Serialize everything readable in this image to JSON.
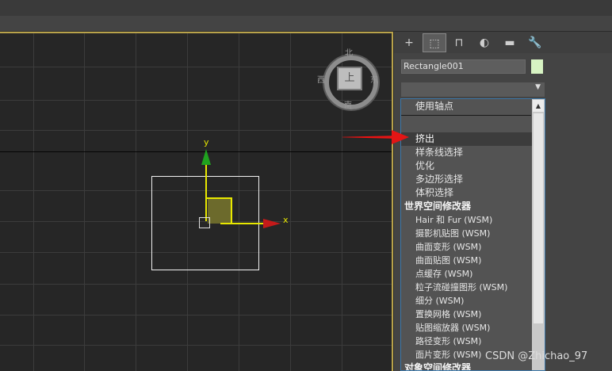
{
  "viewport": {
    "compass": {
      "north": "北",
      "south": "南",
      "east": "东",
      "west": "西",
      "top": "上"
    },
    "gizmo": {
      "x_label": "x",
      "y_label": "y"
    }
  },
  "panel": {
    "tabs": [
      {
        "icon": "plus-icon",
        "glyph": "+"
      },
      {
        "icon": "modify-icon",
        "glyph": "⬚"
      },
      {
        "icon": "hierarchy-icon",
        "glyph": "⊓"
      },
      {
        "icon": "motion-icon",
        "glyph": "◐"
      },
      {
        "icon": "display-icon",
        "glyph": "▬"
      },
      {
        "icon": "utilities-icon",
        "glyph": "🔧"
      }
    ],
    "object_name": "Rectangle001",
    "object_color": "#d7f3c3",
    "modifier_list_value": "",
    "dropdown": {
      "top_item": "使用轴点",
      "items": [
        {
          "label": "挤出",
          "kind": "sub",
          "highlighted": true
        },
        {
          "label": "样条线选择",
          "kind": "sub"
        },
        {
          "label": "优化",
          "kind": "sub"
        },
        {
          "label": "多边形选择",
          "kind": "sub"
        },
        {
          "label": "体积选择",
          "kind": "sub"
        },
        {
          "label": "世界空间修改器",
          "kind": "header"
        },
        {
          "label": "Hair 和 Fur (WSM)",
          "kind": "sub"
        },
        {
          "label": "摄影机贴图 (WSM)",
          "kind": "sub"
        },
        {
          "label": "曲面变形 (WSM)",
          "kind": "sub"
        },
        {
          "label": "曲面贴图 (WSM)",
          "kind": "sub"
        },
        {
          "label": "点缓存 (WSM)",
          "kind": "sub"
        },
        {
          "label": "粒子流碰撞图形 (WSM)",
          "kind": "sub"
        },
        {
          "label": "细分 (WSM)",
          "kind": "sub"
        },
        {
          "label": "置换网格 (WSM)",
          "kind": "sub"
        },
        {
          "label": "贴图缩放器 (WSM)",
          "kind": "sub"
        },
        {
          "label": "路径变形 (WSM)",
          "kind": "sub"
        },
        {
          "label": "面片变形 (WSM)",
          "kind": "sub"
        },
        {
          "label": "对象空间修改器",
          "kind": "header"
        }
      ]
    }
  },
  "watermark": "CSDN @Zhichao_97"
}
